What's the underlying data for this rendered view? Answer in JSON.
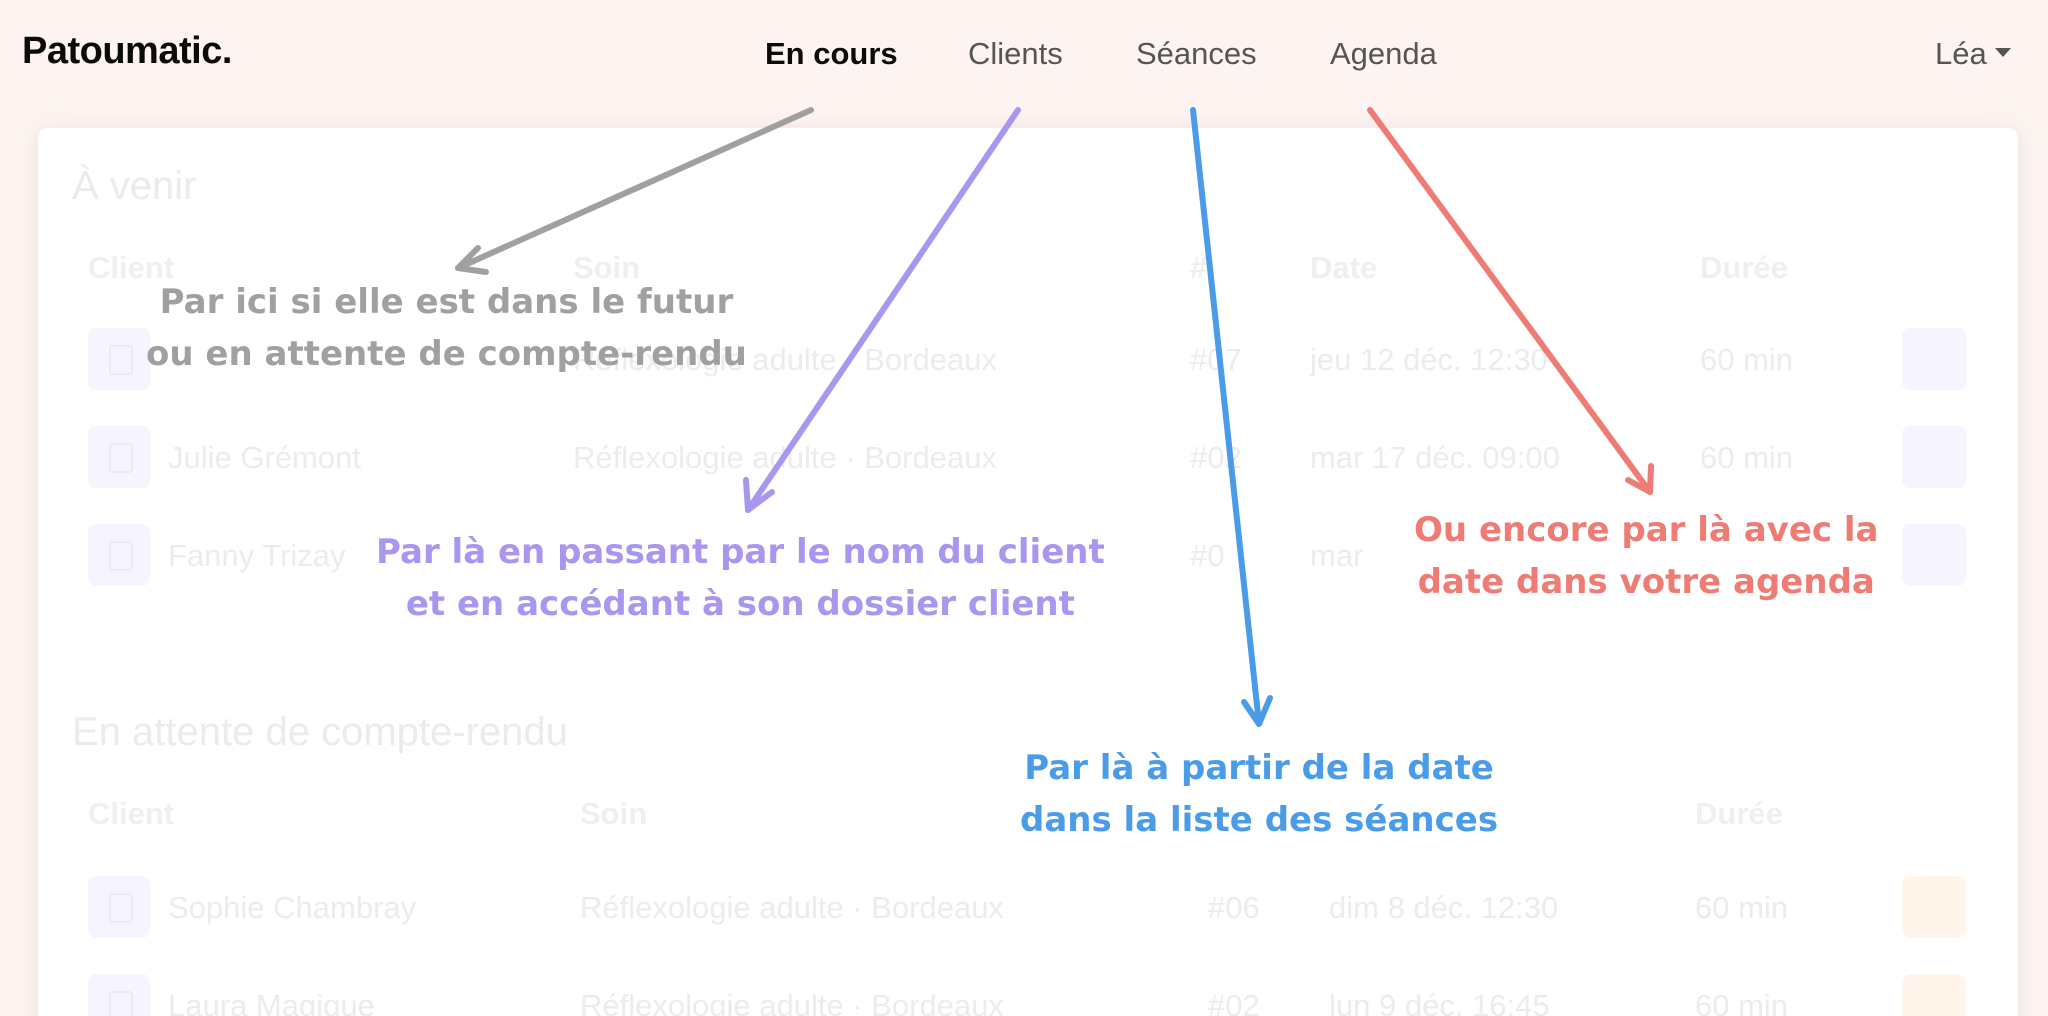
{
  "app": {
    "logo": "Patoumatic."
  },
  "nav": {
    "items": [
      {
        "label": "En cours",
        "active": true
      },
      {
        "label": "Clients",
        "active": false
      },
      {
        "label": "Séances",
        "active": false
      },
      {
        "label": "Agenda",
        "active": false
      }
    ],
    "user": "Léa"
  },
  "upcoming": {
    "title": "À venir",
    "headers": {
      "client": "Client",
      "soin": "Soin",
      "num": "#",
      "date": "Date",
      "duree": "Durée"
    },
    "rows": [
      {
        "client": "",
        "soin": "Réflexologie adulte · Bordeaux",
        "num": "#07",
        "date": "jeu 12 déc. 12:30",
        "duree": "60 min"
      },
      {
        "client": "Julie Grémont",
        "soin": "Réflexologie adulte · Bordeaux",
        "num": "#02",
        "date": "mar 17 déc. 09:00",
        "duree": "60 min"
      },
      {
        "client": "Fanny Trizay",
        "soin": "",
        "num": "#0",
        "date": "mar",
        "duree": ""
      }
    ]
  },
  "pending": {
    "title": "En attente de compte-rendu",
    "headers": {
      "client": "Client",
      "soin": "Soin",
      "duree": "Durée"
    },
    "rows": [
      {
        "client": "Sophie Chambray",
        "soin": "Réflexologie adulte · Bordeaux",
        "num": "#06",
        "date": "dim 8 déc. 12:30",
        "duree": "60 min"
      },
      {
        "client": "Laura Magique",
        "soin": "Réflexologie adulte · Bordeaux",
        "num": "#02",
        "date": "lun 9 déc. 16:45",
        "duree": "60 min"
      }
    ]
  },
  "annotations": {
    "gray": [
      "Par ici si elle est dans le futur",
      "ou en attente de compte-rendu"
    ],
    "purple": [
      "Par là en passant par le nom du client",
      "et en accédant à son dossier client"
    ],
    "blue": [
      "Par là à partir de la date",
      "dans la liste des séances"
    ],
    "red": [
      "Ou encore par là avec la",
      "date dans votre agenda"
    ]
  },
  "colors": {
    "gray": "#a0a0a0",
    "purple": "#a996ef",
    "blue": "#4b9ce8",
    "red": "#ee7c74",
    "background": "#fdf4f1"
  }
}
